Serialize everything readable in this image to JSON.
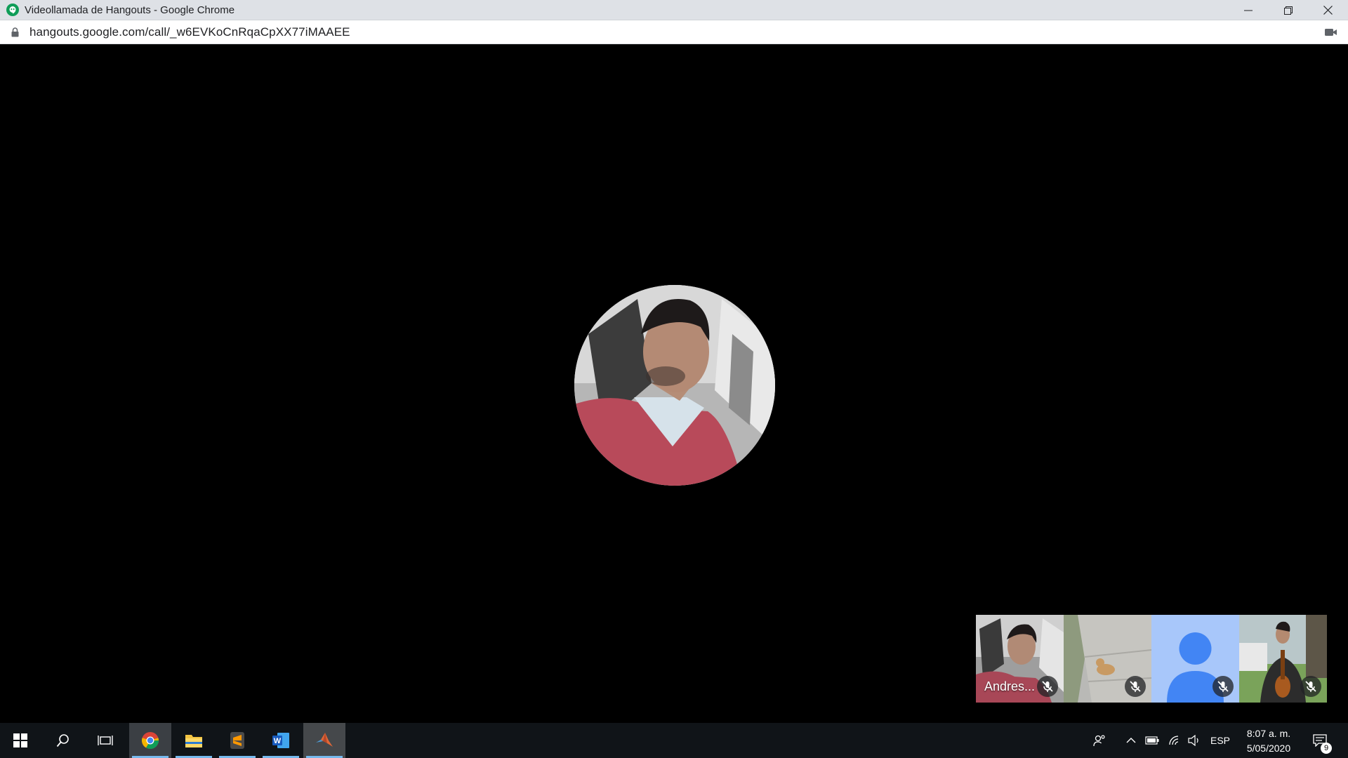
{
  "window": {
    "title": "Videollamada de Hangouts - Google Chrome",
    "url": "hangouts.google.com/call/_w6EVKoCnRqaCpXX77iMAAEE"
  },
  "call": {
    "participants": [
      {
        "name": "Andres...",
        "muted": true
      },
      {
        "name": "",
        "muted": true
      },
      {
        "name": "",
        "muted": true
      },
      {
        "name": "",
        "muted": true
      }
    ]
  },
  "taskbar": {
    "apps": [
      "Google Chrome",
      "File Explorer",
      "Sublime Text",
      "Microsoft Word",
      "MATLAB"
    ],
    "language": "ESP",
    "time": "8:07 a. m.",
    "date": "5/05/2020",
    "notification_count": "9"
  },
  "colors": {
    "titlebar": "#dee1e6",
    "taskbar": "#101418",
    "avatar_placeholder_bg": "#a8c7fa",
    "avatar_placeholder_fg": "#4285f4"
  }
}
